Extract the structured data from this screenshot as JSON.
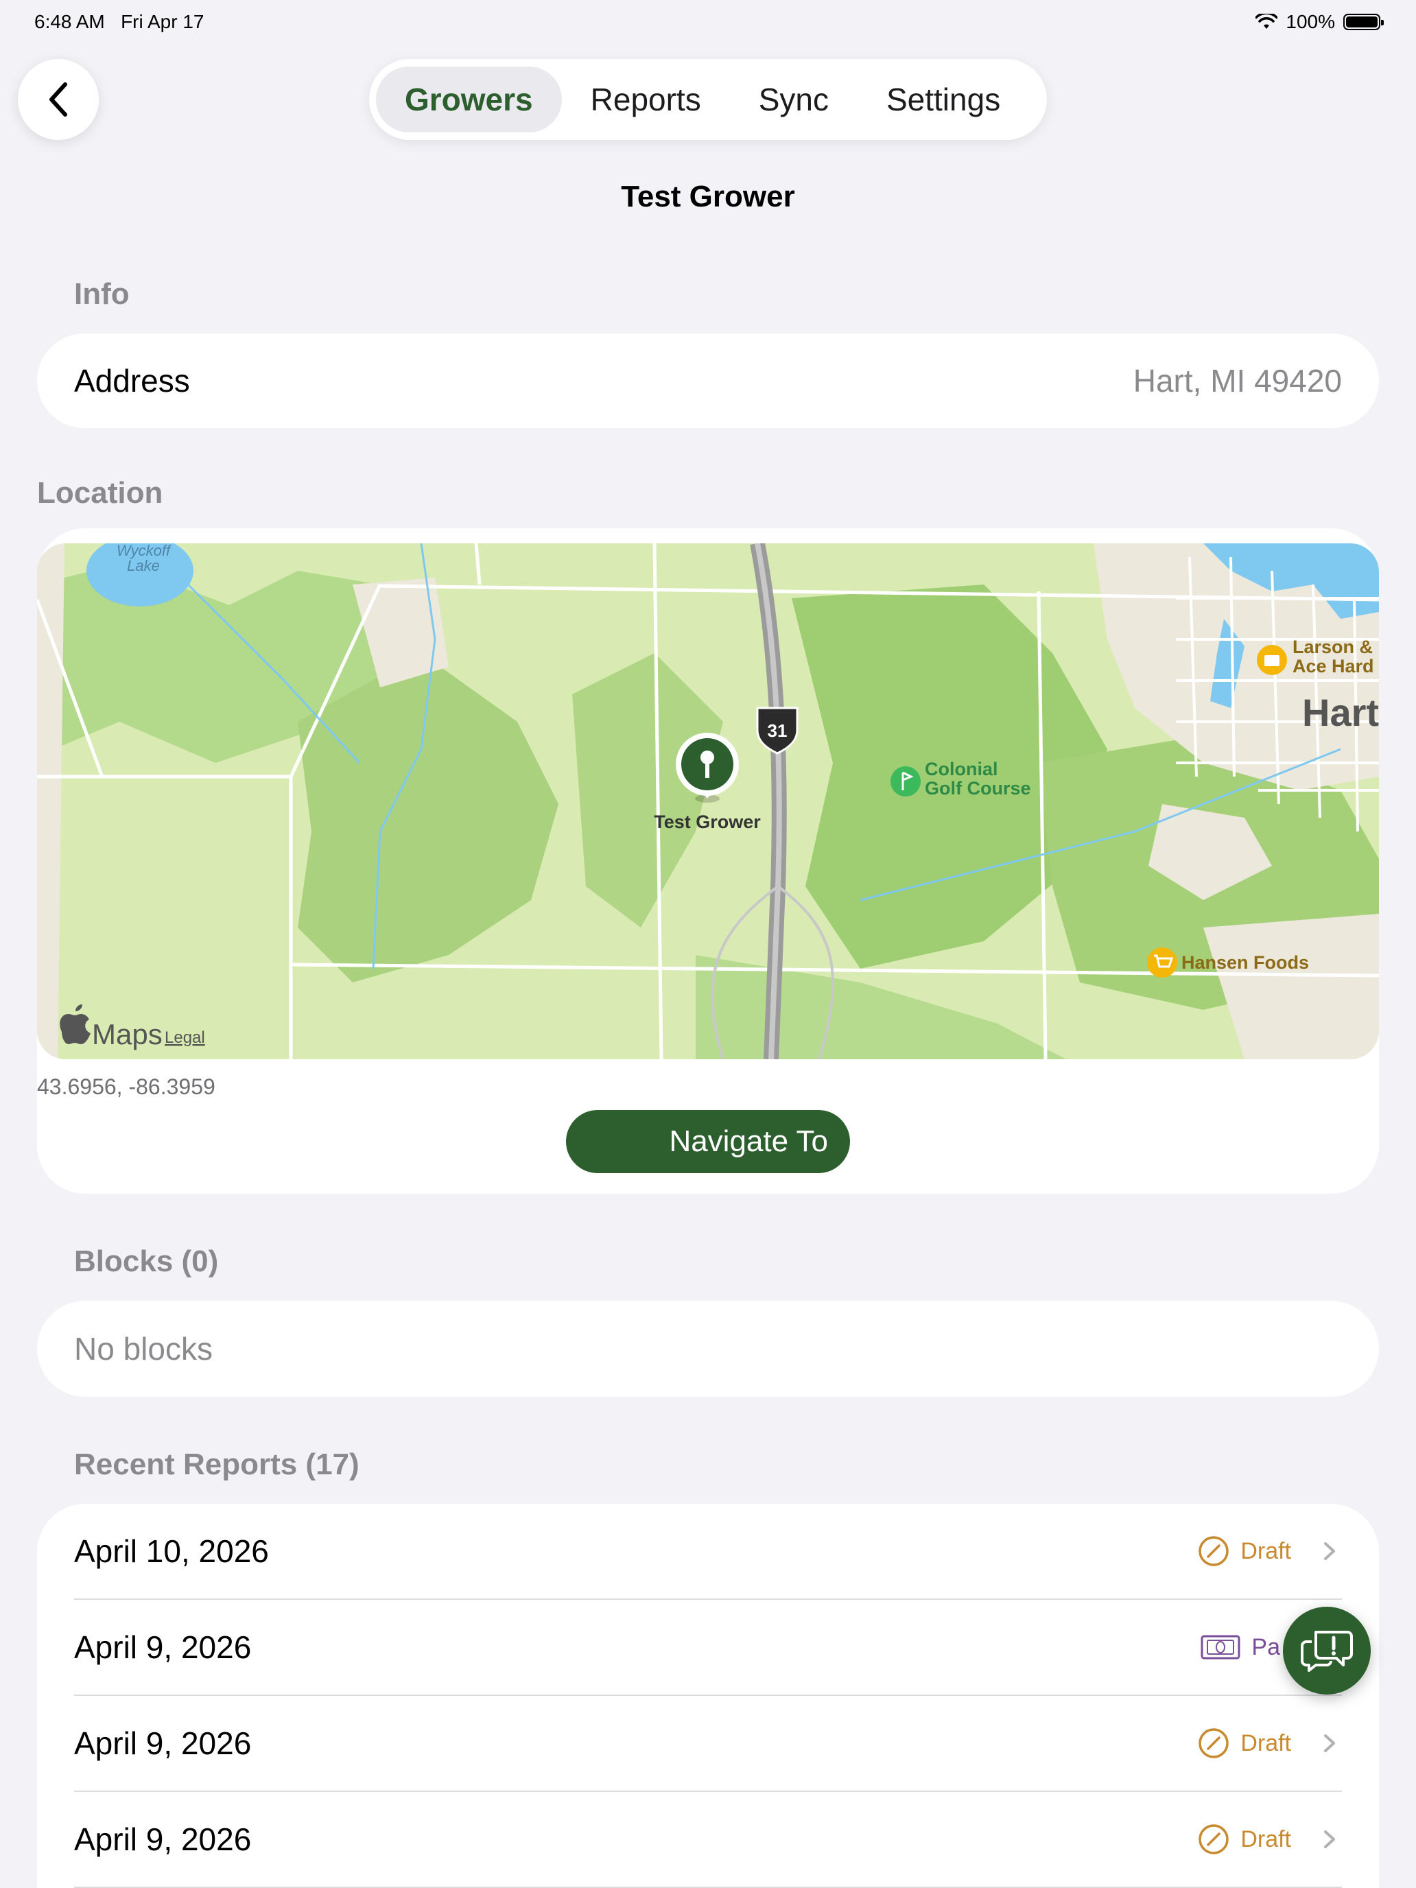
{
  "status_bar": {
    "time": "6:48 AM",
    "date": "Fri Apr 17",
    "battery": "100%"
  },
  "nav": {
    "back_icon": "chevron-left-icon",
    "tabs": [
      {
        "label": "Growers",
        "active": true
      },
      {
        "label": "Reports",
        "active": false
      },
      {
        "label": "Sync",
        "active": false
      },
      {
        "label": "Settings",
        "active": false
      }
    ]
  },
  "page_title": "Test Grower",
  "info": {
    "section_label": "Info",
    "address_label": "Address",
    "address_value": "Hart, MI 49420"
  },
  "location": {
    "section_label": "Location",
    "map": {
      "pin_label": "Test Grower",
      "town_label": "Hart",
      "lake_label_line1": "Wyckoff",
      "lake_label_line2": "Lake",
      "poi_golf_line1": "Colonial",
      "poi_golf_line2": "Golf Course",
      "poi_hardware_line1": "Larson &",
      "poi_hardware_line2": "Ace Hard",
      "poi_food": "Hansen Foods",
      "highway_shield": "31",
      "maps_brand": "Maps",
      "legal_link": "Legal"
    },
    "coordinates": "43.6956, -86.3959",
    "navigate_label": "Navigate To"
  },
  "blocks": {
    "section_label": "Blocks (0)",
    "empty_text": "No blocks"
  },
  "recent_reports": {
    "section_label": "Recent Reports (17)",
    "rows": [
      {
        "date": "April 10, 2026",
        "status": "Draft",
        "status_icon": "draft-icon"
      },
      {
        "date": "April 9, 2026",
        "status": "Pa",
        "status_icon": "cash-icon"
      },
      {
        "date": "April 9, 2026",
        "status": "Draft",
        "status_icon": "draft-icon"
      },
      {
        "date": "April 9, 2026",
        "status": "Draft",
        "status_icon": "draft-icon"
      }
    ]
  },
  "fab_icon": "feedback-chat-icon",
  "colors": {
    "accent": "#2c5e2e",
    "draft": "#c98a2f",
    "paid": "#7b4e9a",
    "background": "#f2f2f7"
  }
}
